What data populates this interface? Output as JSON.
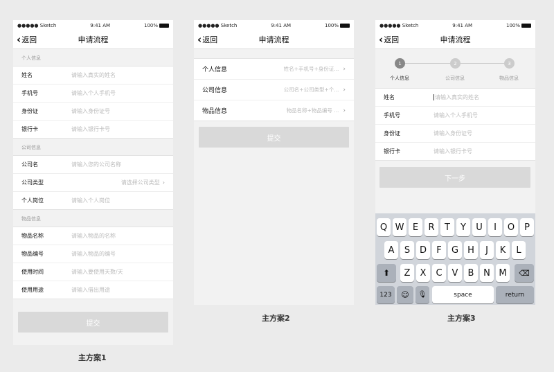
{
  "status": {
    "carrier": "●●●●● Sketch",
    "time": "9:41 AM",
    "battery": "100%"
  },
  "nav": {
    "back": "返回",
    "title": "申请流程"
  },
  "plan1": {
    "caption": "主方案1",
    "sections": [
      {
        "label": "个人信息",
        "rows": [
          {
            "label": "姓名",
            "placeholder": "请输入真实的姓名"
          },
          {
            "label": "手机号",
            "placeholder": "请输入个人手机号"
          },
          {
            "label": "身份证",
            "placeholder": "请输入身份证号"
          },
          {
            "label": "银行卡",
            "placeholder": "请输入银行卡号"
          }
        ]
      },
      {
        "label": "公司信息",
        "rows": [
          {
            "label": "公司名",
            "placeholder": "请输入您的公司名称"
          },
          {
            "label": "公司类型",
            "right": "请选择公司类型"
          },
          {
            "label": "个人岗位",
            "placeholder": "请输入个人岗位"
          }
        ]
      },
      {
        "label": "物品信息",
        "rows": [
          {
            "label": "物品名称",
            "placeholder": "请输入物品的名称"
          },
          {
            "label": "物品编号",
            "placeholder": "请输入物品的编号"
          },
          {
            "label": "使用时间",
            "placeholder": "请输入要使用天数/天"
          },
          {
            "label": "使用用途",
            "placeholder": "请输入借出用途"
          }
        ]
      }
    ],
    "submit": "提交"
  },
  "plan2": {
    "caption": "主方案2",
    "rows": [
      {
        "label": "个人信息",
        "right": "姓名+手机号+身份证..."
      },
      {
        "label": "公司信息",
        "right": "公司名+公司类型+个..."
      },
      {
        "label": "物品信息",
        "right": "物品名称+物品编号 ..."
      }
    ],
    "submit": "提交"
  },
  "plan3": {
    "caption": "主方案3",
    "steps": [
      {
        "num": "1",
        "label": "个人信息"
      },
      {
        "num": "2",
        "label": "公司信息"
      },
      {
        "num": "3",
        "label": "物品信息"
      }
    ],
    "rows": [
      {
        "label": "姓名",
        "placeholder": "请输入真实的姓名"
      },
      {
        "label": "手机号",
        "placeholder": "请输入个人手机号"
      },
      {
        "label": "身份证",
        "placeholder": "请输入身份证号"
      },
      {
        "label": "银行卡",
        "placeholder": "请输入银行卡号"
      }
    ],
    "next": "下一步",
    "keyboard": {
      "row1": [
        "Q",
        "W",
        "E",
        "R",
        "T",
        "Y",
        "U",
        "I",
        "O",
        "P"
      ],
      "row2": [
        "A",
        "S",
        "D",
        "F",
        "G",
        "H",
        "J",
        "K",
        "L"
      ],
      "row3": [
        "Z",
        "X",
        "C",
        "V",
        "B",
        "N",
        "M"
      ],
      "num": "123",
      "space": "space",
      "return": "return"
    }
  }
}
